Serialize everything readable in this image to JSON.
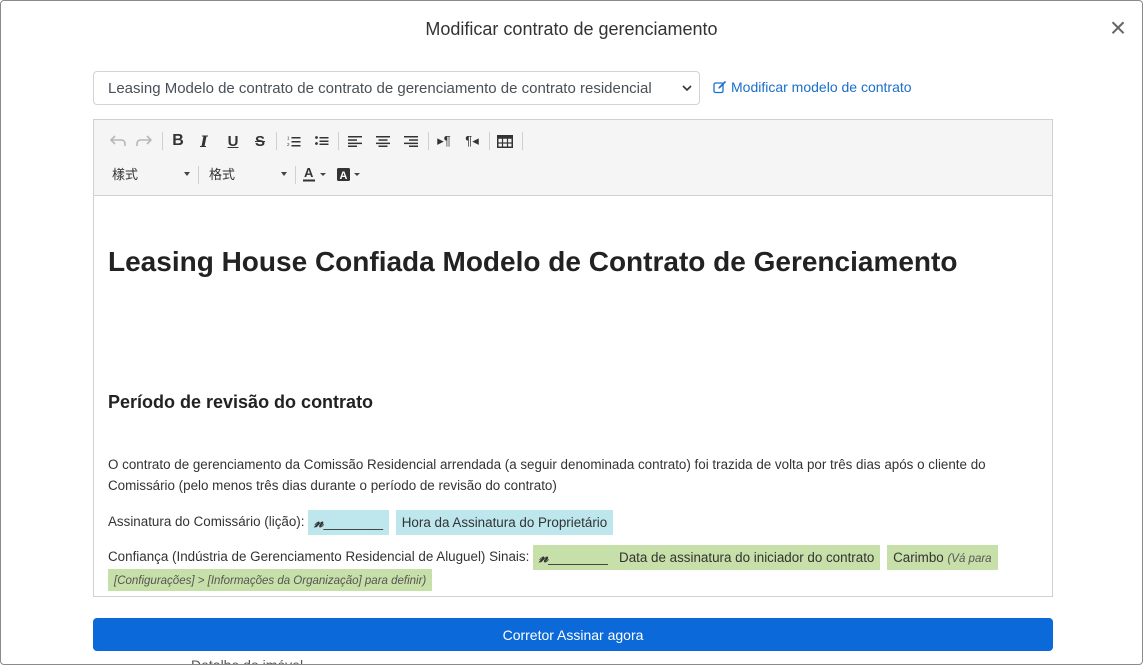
{
  "modal": {
    "title": "Modificar contrato de gerenciamento",
    "close_symbol": "×"
  },
  "template_select": {
    "value": "Leasing Modelo de contrato de contrato de gerenciamento de contrato residencial"
  },
  "edit_template_link": {
    "label": "Modificar modelo de contrato",
    "icon": "edit-icon"
  },
  "toolbar": {
    "style_select": "樣式",
    "format_select": "格式",
    "buttons": [
      "undo-icon",
      "redo-icon",
      "bold-icon",
      "italic-icon",
      "underline-icon",
      "strikethrough-icon",
      "ordered-list-icon",
      "unordered-list-icon",
      "align-left-icon",
      "align-center-icon",
      "align-right-icon",
      "ltr-icon",
      "rtl-icon",
      "table-icon",
      "text-color-icon",
      "background-color-icon"
    ]
  },
  "document": {
    "title": "Leasing House Confiada Modelo de Contrato de Gerenciamento",
    "section_title": "Período de revisão do contrato",
    "paragraph": "O contrato de gerenciamento da Comissão Residencial arrendada (a seguir denominada contrato) foi trazida de volta por três dias após o cliente do Comissário (pelo menos três dias durante o período de revisão do contrato)",
    "commissioner_sig_label": "Assinatura do Comissário (lição):",
    "commissioner_sig_blank": "________",
    "owner_sig_time": "Hora da Assinatura do Proprietário",
    "trust_label": "Confiança (Indústria de Gerenciamento Residencial de Aluguel) Sinais:",
    "trust_sig_blank": "________",
    "initiator_date": "Data de assinatura do iniciador do contrato",
    "stamp_label": "Carimbo",
    "stamp_hint_1": "(Vá para",
    "stamp_hint_2": "[Configurações] > [Informações da Organização] para definir)"
  },
  "colors": {
    "primary": "#0b69d9",
    "chip_blue": "#bde7ed",
    "chip_green": "#c7dfa8",
    "link": "#1a6fc9"
  },
  "submit_button": {
    "label": "Corretor Assinar agora"
  },
  "behind_text": "Detalhe do imóvel"
}
